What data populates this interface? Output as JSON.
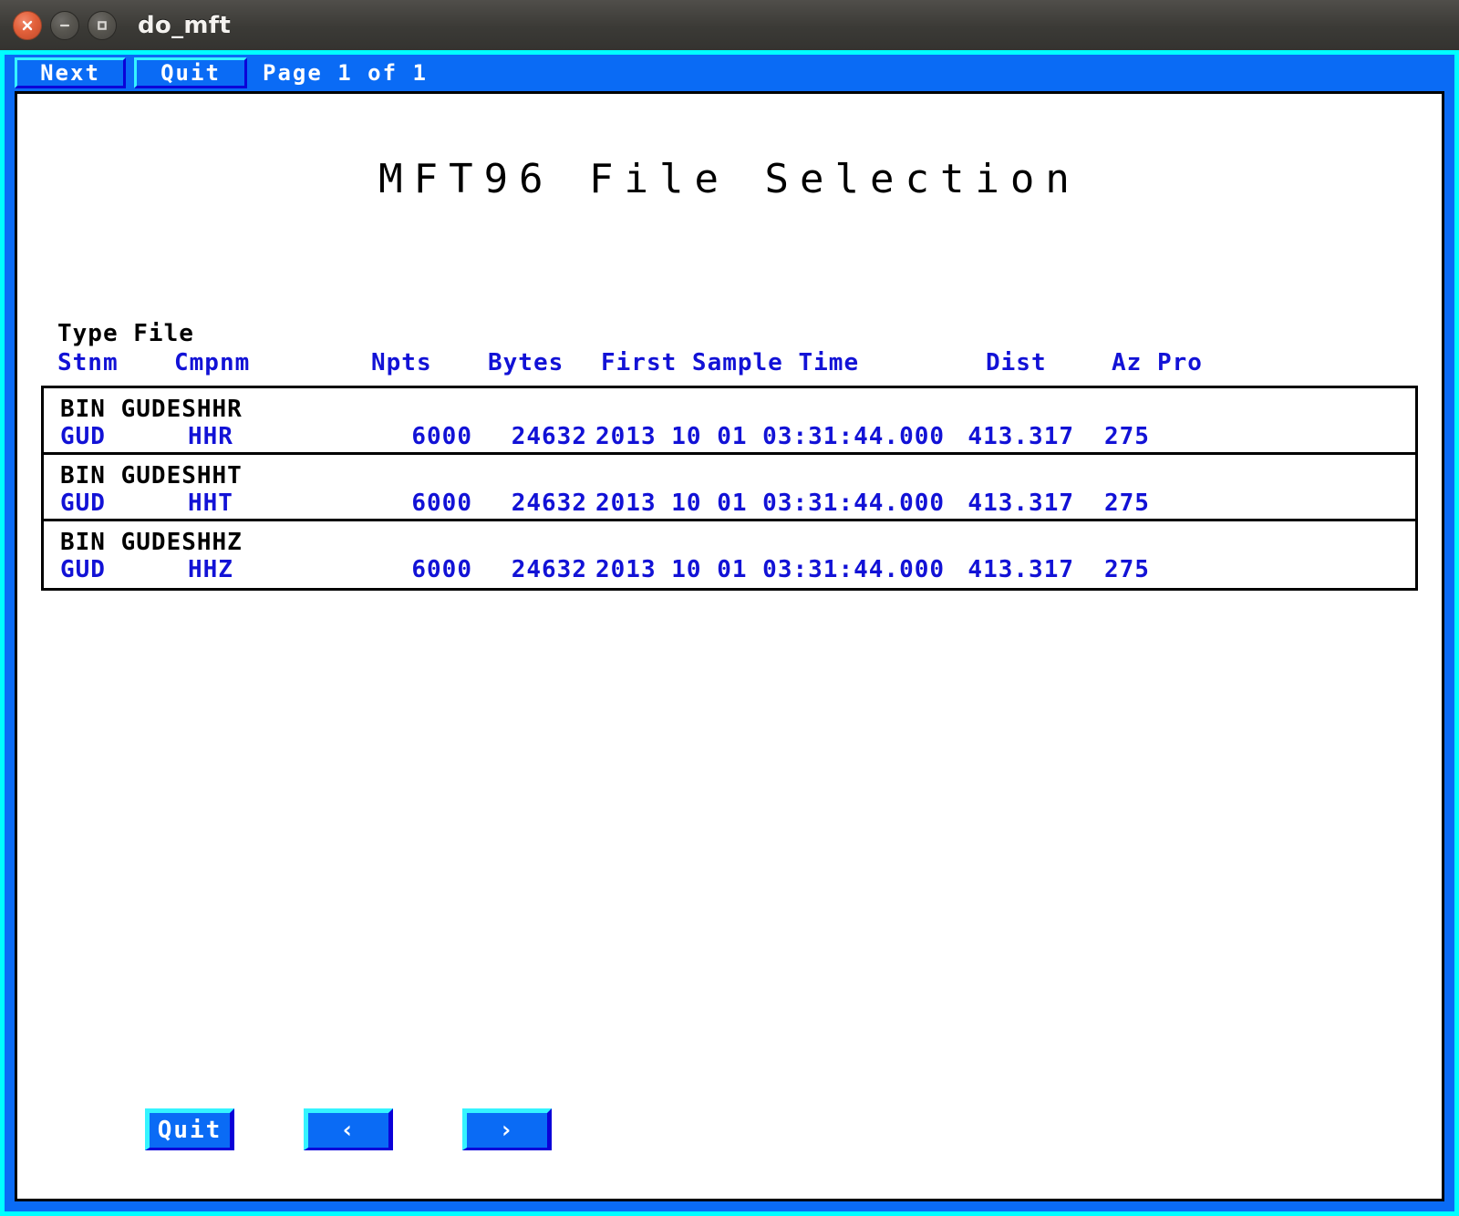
{
  "window": {
    "title": "do_mft",
    "controls": [
      {
        "name": "close-button",
        "glyph": "x"
      },
      {
        "name": "minimize-button",
        "glyph": "-"
      },
      {
        "name": "maximize-button",
        "glyph": "square"
      }
    ]
  },
  "menubar": {
    "next_label": "Next",
    "quit_label": "Quit",
    "page_label": "Page 1 of 1"
  },
  "page": {
    "title": "MFT96 File Selection",
    "type_file_label": "Type File"
  },
  "table": {
    "headers": {
      "stnm": "Stnm",
      "cmpnm": "Cmpnm",
      "npts": "Npts",
      "bytes": "Bytes",
      "first_sample_time": "First Sample Time",
      "dist": "Dist",
      "az_pro": "Az Pro"
    },
    "rows": [
      {
        "type_file": "BIN GUDESHHR",
        "stnm": "GUD",
        "cmpnm": "HHR",
        "npts": "6000",
        "bytes": "24632",
        "first_sample_time": "2013 10 01 03:31:44.000",
        "dist": "413.317",
        "az": "275"
      },
      {
        "type_file": "BIN GUDESHHT",
        "stnm": "GUD",
        "cmpnm": "HHT",
        "npts": "6000",
        "bytes": "24632",
        "first_sample_time": "2013 10 01 03:31:44.000",
        "dist": "413.317",
        "az": "275"
      },
      {
        "type_file": "BIN GUDESHHZ",
        "stnm": "GUD",
        "cmpnm": "HHZ",
        "npts": "6000",
        "bytes": "24632",
        "first_sample_time": "2013 10 01 03:31:44.000",
        "dist": "413.317",
        "az": "275"
      }
    ]
  },
  "footer": {
    "quit_label": "Quit",
    "prev_label": "‹",
    "next_label": "›"
  },
  "colors": {
    "accent_blue": "#0a6bf5",
    "text_blue": "#1212d6",
    "bevel_light": "#35f4ff",
    "bevel_dark": "#0b00d8",
    "outer_border": "#00ffff",
    "canvas": "#ffffff",
    "titlebar": "#3b3a36",
    "close_button": "#e2603a"
  }
}
